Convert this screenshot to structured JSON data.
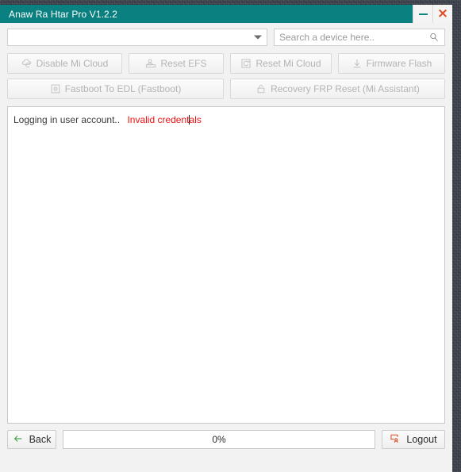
{
  "window": {
    "title": "Anaw Ra Htar Pro V1.2.2",
    "controls": {
      "minimize_name": "minimize-icon",
      "close_label": "×",
      "accent_teal": "#0a8080",
      "close_color": "#e04a21"
    }
  },
  "toolbar": {
    "device_combo": {
      "value": "",
      "icon": "chevron-down-icon"
    },
    "search": {
      "value": "",
      "placeholder": "Search a device here..",
      "icon": "search-icon"
    }
  },
  "actions": {
    "row1": [
      {
        "id": "disable-mi-cloud",
        "label": "Disable Mi Cloud",
        "icon": "cloud-refresh-icon",
        "enabled": false
      },
      {
        "id": "reset-efs",
        "label": "Reset EFS",
        "icon": "user-card-icon",
        "enabled": false
      },
      {
        "id": "reset-mi-cloud",
        "label": "Reset Mi Cloud",
        "icon": "reset-clock-icon",
        "enabled": false
      },
      {
        "id": "firmware-flash",
        "label": "Firmware Flash",
        "icon": "download-arrow-icon",
        "enabled": false
      }
    ],
    "row2": [
      {
        "id": "fastboot-to-edl",
        "label": "Fastboot To EDL (Fastboot)",
        "icon": "chip-icon",
        "enabled": false
      },
      {
        "id": "recovery-frp-reset",
        "label": "Recovery FRP Reset (Mi Assistant)",
        "icon": "lock-icon",
        "enabled": false
      }
    ]
  },
  "log": {
    "lines": [
      {
        "normal": "Logging in user account..",
        "error_before_caret": "Invalid credent",
        "error_after_caret": "als",
        "error_color": "#ee1111"
      }
    ]
  },
  "bottom": {
    "back_label": "Back",
    "back_icon": "arrow-left-icon",
    "progress": {
      "percent_label": "0%",
      "percent_value": 0
    },
    "logout_label": "Logout",
    "logout_icon": "logout-user-icon"
  }
}
